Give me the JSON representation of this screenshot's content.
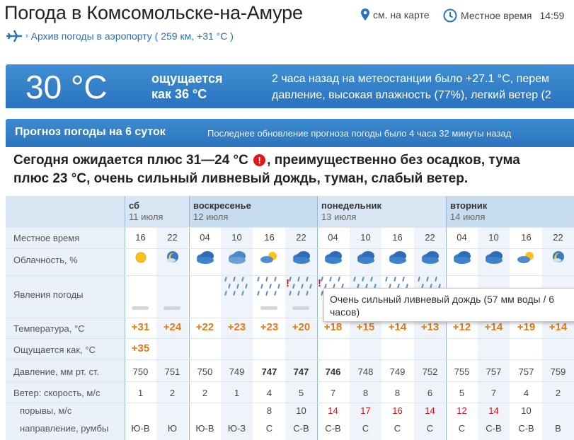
{
  "header": {
    "title": "Погода в Комсомольске-на-Амуре",
    "map_link": "см. на карте",
    "local_time_label": "Местное время",
    "local_time": "14:59",
    "archive_link": "Архив погоды в аэропорту ( 259 км, +31 °C )"
  },
  "current": {
    "temperature": "30 °C",
    "feels_line1": "ощущается",
    "feels_line2": "как 36 °C",
    "desc_line1": "2 часа назад на метеостанции было +27.1 °C, перем",
    "desc_line2": "давление, высокая влажность (77%), легкий ветер (2"
  },
  "forecast": {
    "heading": "Прогноз погоды на 6 суток",
    "updated": "Последнее обновление прогноза погоды было 4 часа 32 минуты назад",
    "summary_line1_a": "Сегодня ожидается плюс 31—24 °C",
    "summary_warn": "!",
    "summary_line1_b": ", преимущественно без осадков, тума",
    "summary_line2": "плюс 23 °C, очень сильный ливневый дождь, туман, слабый ветер."
  },
  "row_labels": {
    "local_time": "Местное время",
    "cloudiness": "Облачность, %",
    "phenomena": "Явления погоды",
    "temperature": "Температура, °C",
    "feels_like": "Ощущается как, °C",
    "pressure": "Давление, мм рт. ст.",
    "wind_speed": "Ветер: скорость, м/с",
    "gusts": "порывы, м/с",
    "direction": "направление, румбы"
  },
  "days": [
    {
      "name": "сб",
      "date": "11 июля"
    },
    {
      "name": "воскресенье",
      "date": "12 июля"
    },
    {
      "name": "понедельник",
      "date": "13 июля"
    },
    {
      "name": "вторник",
      "date": "14 июля"
    }
  ],
  "columns": [
    {
      "hour": "16",
      "temp": "+31",
      "feels": "+35",
      "pressure": "750",
      "wind": "1",
      "gust": "",
      "dir": "Ю-В",
      "sky": "sun-icon"
    },
    {
      "hour": "22",
      "temp": "+24",
      "feels": "",
      "pressure": "751",
      "wind": "2",
      "gust": "",
      "dir": "Ю",
      "sky": "moon-cloud-icon"
    },
    {
      "hour": "04",
      "temp": "+22",
      "feels": "",
      "pressure": "750",
      "wind": "2",
      "gust": "",
      "dir": "Ю-В",
      "sky": "cloud-icon"
    },
    {
      "hour": "10",
      "temp": "+23",
      "feels": "",
      "pressure": "749",
      "wind": "1",
      "gust": "",
      "dir": "Ю-З",
      "sky": "rain-cloud-icon"
    },
    {
      "hour": "16",
      "temp": "+23",
      "feels": "",
      "pressure": "747",
      "wind": "4",
      "gust": "8",
      "dir": "С",
      "sky": "sun-cloud-icon"
    },
    {
      "hour": "22",
      "temp": "+20",
      "feels": "",
      "pressure": "747",
      "wind": "5",
      "gust": "10",
      "dir": "С-В",
      "sky": "cloud-icon"
    },
    {
      "hour": "04",
      "temp": "+18",
      "feels": "",
      "pressure": "746",
      "wind": "7",
      "gust": "14",
      "dir": "С-В",
      "sky": "cloud-icon"
    },
    {
      "hour": "10",
      "temp": "+15",
      "feels": "",
      "pressure": "748",
      "wind": "8",
      "gust": "17",
      "dir": "С",
      "sky": "cloud-icon"
    },
    {
      "hour": "16",
      "temp": "+14",
      "feels": "",
      "pressure": "749",
      "wind": "8",
      "gust": "16",
      "dir": "С",
      "sky": "cloud-icon"
    },
    {
      "hour": "22",
      "temp": "+13",
      "feels": "",
      "pressure": "752",
      "wind": "6",
      "gust": "14",
      "dir": "С",
      "sky": "cloud-icon"
    },
    {
      "hour": "04",
      "temp": "+12",
      "feels": "",
      "pressure": "755",
      "wind": "5",
      "gust": "12",
      "dir": "С",
      "sky": "cloud-icon"
    },
    {
      "hour": "10",
      "temp": "+14",
      "feels": "",
      "pressure": "757",
      "wind": "7",
      "gust": "14",
      "dir": "С-В",
      "sky": "cloud-icon"
    },
    {
      "hour": "16",
      "temp": "+19",
      "feels": "",
      "pressure": "757",
      "wind": "4",
      "gust": "10",
      "dir": "С-В",
      "sky": "sun-cloud-icon"
    },
    {
      "hour": "22",
      "temp": "+14",
      "feels": "",
      "pressure": "759",
      "wind": "2",
      "gust": "",
      "dir": "В",
      "sky": "moon-cloud-icon"
    }
  ],
  "tooltip": {
    "line1": "Очень сильный ливневый дождь (57 мм воды / 6",
    "line2": "часов)"
  },
  "colors": {
    "accent": "#2a73bf",
    "temperature": "#e07b17",
    "danger": "#d4121a"
  }
}
